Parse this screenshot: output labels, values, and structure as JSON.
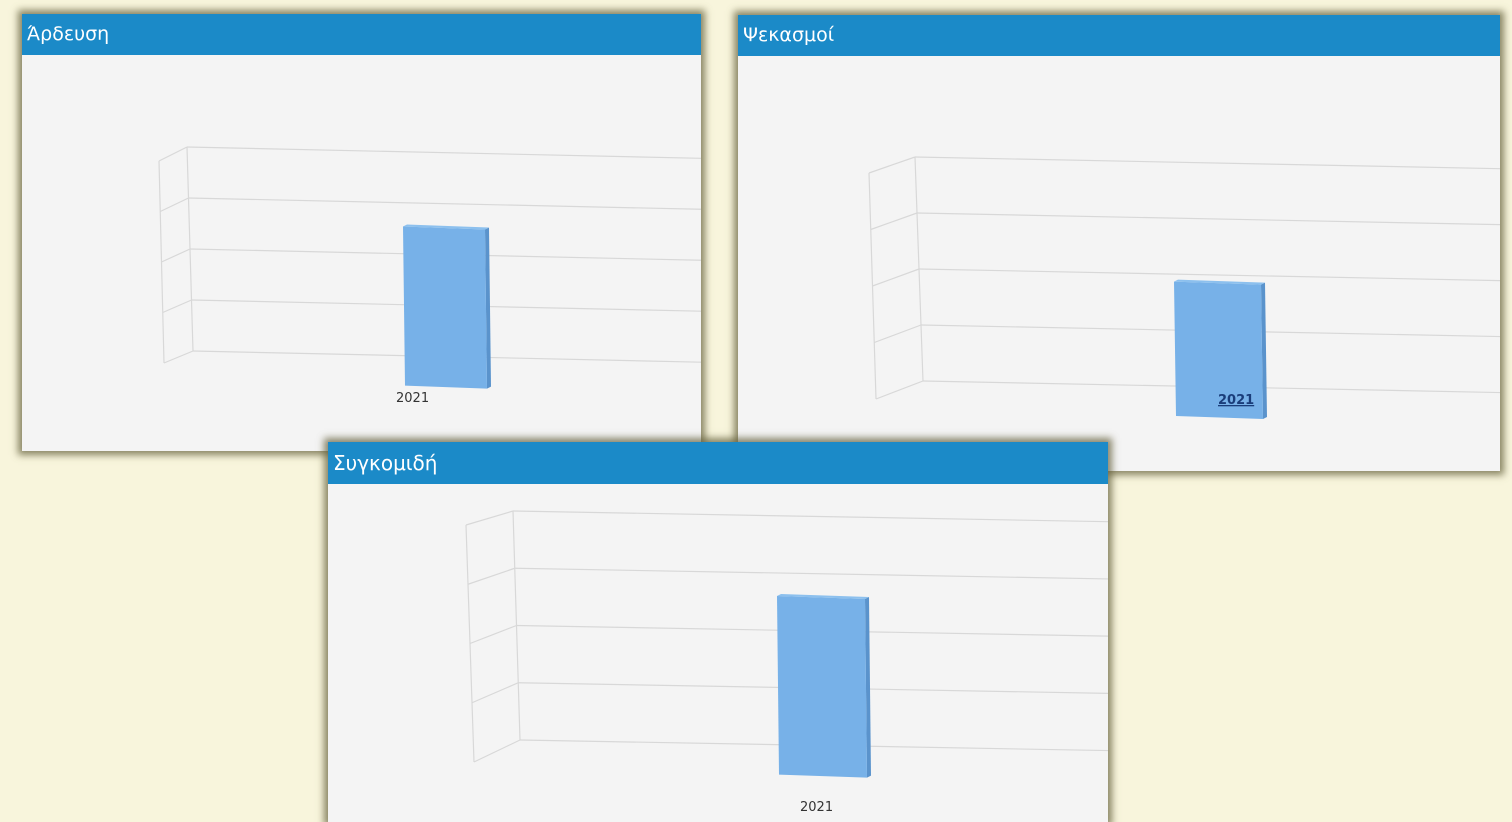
{
  "colors": {
    "background": "#f8f5dc",
    "panel": "#f4f4f4",
    "header": "#1b8ac8",
    "header_text": "#ffffff",
    "bar_front": "#77b1e8",
    "bar_side": "#5a93cc",
    "bar_top": "#8cc0ee",
    "gridline": "#d8d8d8",
    "tick_label": "#333333",
    "link_label": "#1a3d7a"
  },
  "chart_data": [
    {
      "type": "bar",
      "title": "Άρδευση",
      "categories": [
        "2021"
      ],
      "values": [
        0.78
      ],
      "ylim": [
        0,
        1
      ],
      "grid": true,
      "three_d": true
    },
    {
      "type": "bar",
      "title": "Ψεκασμοί",
      "categories": [
        "2021"
      ],
      "values": [
        0.6
      ],
      "ylim": [
        0,
        1
      ],
      "grid": true,
      "three_d": true,
      "tick_label_underlined": true
    },
    {
      "type": "bar",
      "title": "Συγκομιδή",
      "categories": [
        "2021"
      ],
      "values": [
        0.78
      ],
      "ylim": [
        0,
        1
      ],
      "grid": true,
      "three_d": true
    }
  ]
}
